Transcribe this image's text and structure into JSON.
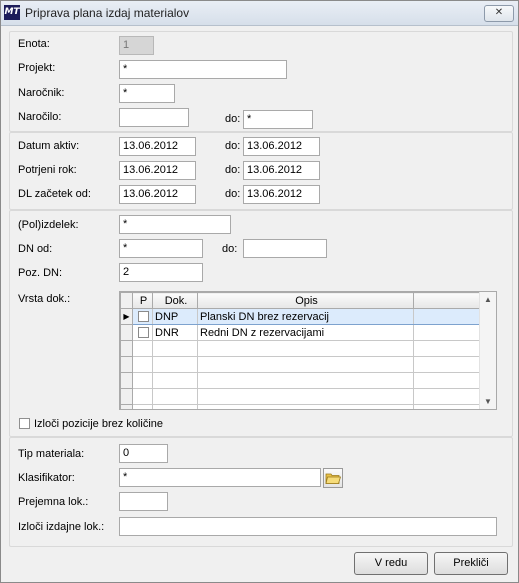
{
  "window": {
    "title": "Priprava plana izdaj materialov",
    "app_icon": "MT",
    "close_label": "✕"
  },
  "group1": {
    "enota": {
      "label": "Enota:",
      "value": "1"
    },
    "projekt": {
      "label": "Projekt:",
      "value": "*"
    },
    "narocnik": {
      "label": "Naročnik:",
      "value": "*"
    },
    "narocilo": {
      "label": "Naročilo:",
      "value": "",
      "to_label": "do:",
      "to_value": "*"
    }
  },
  "group2": {
    "datum_aktiv": {
      "label": "Datum aktiv:",
      "from": "13.06.2012",
      "to_label": "do:",
      "to": "13.06.2012"
    },
    "potrjeni_rok": {
      "label": "Potrjeni rok:",
      "from": "13.06.2012",
      "to_label": "do:",
      "to": "13.06.2012"
    },
    "dl_zacetek": {
      "label": "DL začetek od:",
      "from": "13.06.2012",
      "to_label": "do:",
      "to": "13.06.2012"
    }
  },
  "group3": {
    "polizdelek": {
      "label": "(Pol)izdelek:",
      "value": "*"
    },
    "dn_od": {
      "label": "DN od:",
      "value": "*",
      "to_label": "do:",
      "to_value": ""
    },
    "poz_dn": {
      "label": "Poz. DN:",
      "value": "2"
    },
    "vrsta_dok": {
      "label": "Vrsta dok.:",
      "columns": [
        "P",
        "Dok.",
        "Opis"
      ],
      "rows": [
        {
          "checked": false,
          "dok": "DNP",
          "opis": "Planski DN brez rezervacij",
          "selected": true
        },
        {
          "checked": false,
          "dok": "DNR",
          "opis": "Redni DN z rezervacijami",
          "selected": false
        }
      ]
    },
    "izloci_pozicije": {
      "label": "Izloči pozicije brez količine",
      "checked": false
    }
  },
  "group4": {
    "tip_materiala": {
      "label": "Tip materiala:",
      "value": "0"
    },
    "klasifikator": {
      "label": "Klasifikator:",
      "value": "*"
    },
    "prejemna_lok": {
      "label": "Prejemna lok.:",
      "value": ""
    },
    "izloci_izdajne": {
      "label": "Izloči izdajne lok.:",
      "value": ""
    }
  },
  "buttons": {
    "ok": "V redu",
    "cancel": "Prekliči"
  }
}
